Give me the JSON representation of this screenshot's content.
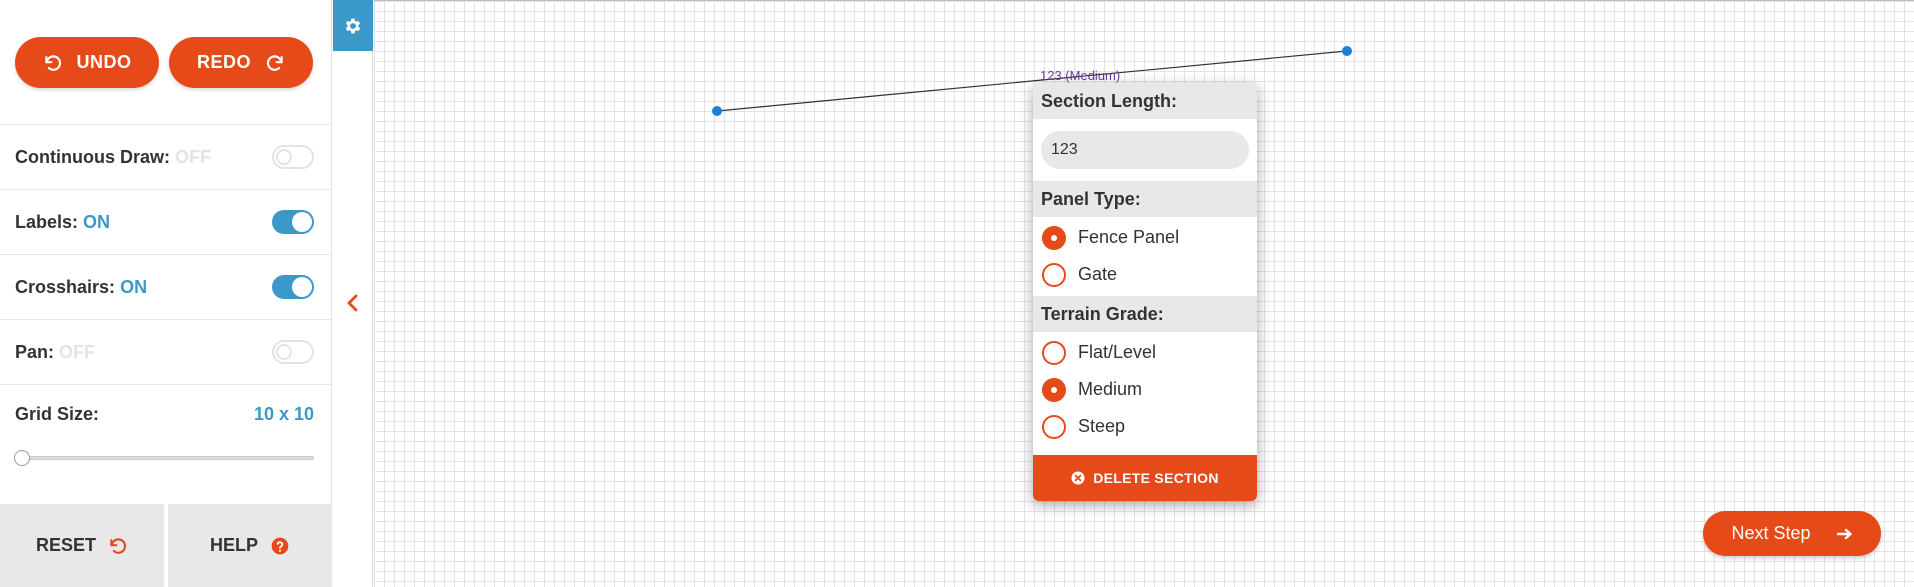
{
  "colors": {
    "accent": "#e64a19",
    "on_blue": "#3a99c8",
    "off_gray": "#e3e3e3",
    "line_label": "#6a3ea1",
    "endpoint": "#1e7fd6"
  },
  "toolbar": {
    "undo_label": "UNDO",
    "redo_label": "REDO",
    "undo_icon": "undo-arrow-icon",
    "redo_icon": "redo-arrow-icon"
  },
  "settings": {
    "continuous_draw": {
      "label": "Continuous Draw:",
      "state": "OFF",
      "on": false
    },
    "labels": {
      "label": "Labels:",
      "state": "ON",
      "on": true
    },
    "crosshairs": {
      "label": "Crosshairs:",
      "state": "ON",
      "on": true
    },
    "pan": {
      "label": "Pan:",
      "state": "OFF",
      "on": false
    },
    "grid_size": {
      "label": "Grid Size:",
      "value": "10 x 10",
      "slider_fraction": 0
    }
  },
  "footer": {
    "reset_label": "RESET",
    "help_label": "HELP",
    "reset_icon": "reset-icon",
    "help_icon": "help-icon"
  },
  "canvas": {
    "section_label": "123 (Medium)"
  },
  "popover": {
    "section_length_header": "Section Length:",
    "section_length_value": "123",
    "panel_type_header": "Panel Type:",
    "panel_types": [
      "Fence Panel",
      "Gate"
    ],
    "panel_type_selected": "Fence Panel",
    "terrain_header": "Terrain Grade:",
    "terrains": [
      "Flat/Level",
      "Medium",
      "Steep"
    ],
    "terrain_selected": "Medium",
    "delete_label": "DELETE SECTION"
  },
  "next_step": {
    "label": "Next Step",
    "icon": "arrow-right-icon"
  }
}
